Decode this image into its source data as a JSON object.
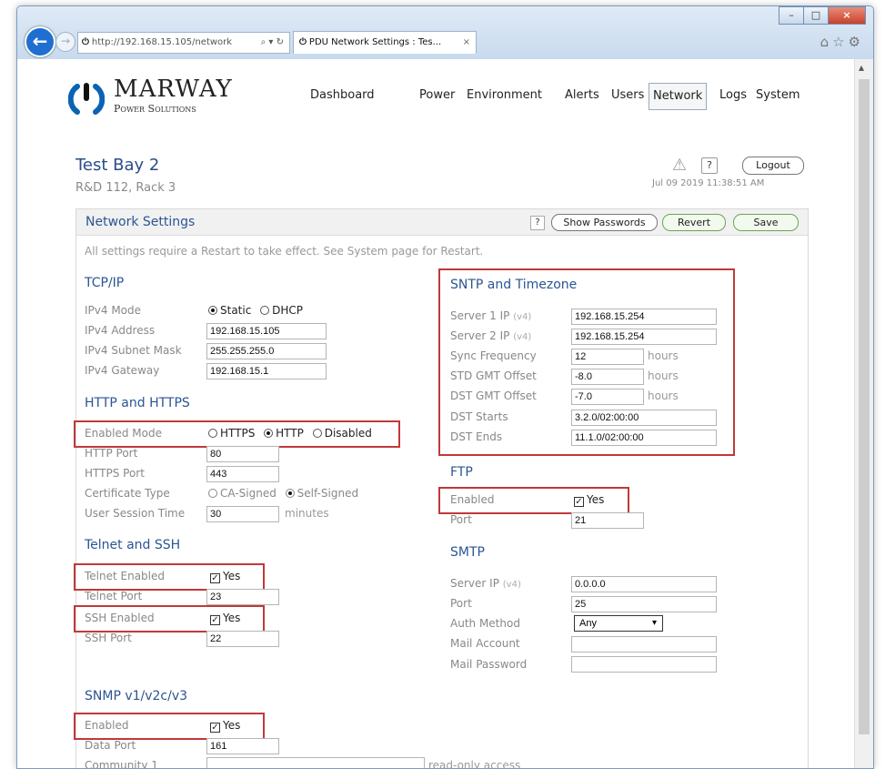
{
  "browser": {
    "url": "http://192.168.15.105/network",
    "search_controls": "⌕ ▾ ↻",
    "tab_title": "PDU Network Settings : Tes...",
    "tab_close": "×",
    "back_icon": "←",
    "forward_icon": "→",
    "toolbar_icons": "⌂☆⚙",
    "window_buttons": {
      "minimize": "–",
      "maximize": "□",
      "close": "×"
    }
  },
  "brand": {
    "name": "MARWAY",
    "sub": "Power Solutions",
    "color": "#0a63b5"
  },
  "nav": [
    "Dashboard",
    "Power",
    "Environment",
    "Alerts",
    "Users",
    "Network",
    "Logs",
    "System"
  ],
  "nav_active": "Network",
  "page": {
    "title": "Test Bay 2",
    "location": "R&D 112, Rack 3",
    "timestamp": "Jul 09 2019 11:38:51 AM",
    "logout": "Logout",
    "help": "?",
    "warn": "⚠"
  },
  "panel": {
    "title": "Network Settings",
    "help": "?",
    "show_passwords": "Show Passwords",
    "revert": "Revert",
    "save": "Save",
    "note": "All settings require a Restart to take effect. See System page for Restart."
  },
  "tcpip": {
    "title": "TCP/IP",
    "mode_label": "IPv4 Mode",
    "mode_static": "Static",
    "mode_dhcp": "DHCP",
    "mode_value": "Static",
    "address_label": "IPv4 Address",
    "address": "192.168.15.105",
    "mask_label": "IPv4 Subnet Mask",
    "mask": "255.255.255.0",
    "gateway_label": "IPv4 Gateway",
    "gateway": "192.168.15.1"
  },
  "http": {
    "title": "HTTP and HTTPS",
    "mode_label": "Enabled Mode",
    "opt_https": "HTTPS",
    "opt_http": "HTTP",
    "opt_disabled": "Disabled",
    "mode_value": "HTTP",
    "http_port_label": "HTTP Port",
    "http_port": "80",
    "https_port_label": "HTTPS Port",
    "https_port": "443",
    "cert_label": "Certificate Type",
    "cert_ca": "CA-Signed",
    "cert_self": "Self-Signed",
    "cert_value": "Self-Signed",
    "session_label": "User Session Time",
    "session": "30",
    "session_unit": "minutes"
  },
  "telnet": {
    "title": "Telnet and SSH",
    "telnet_enabled_label": "Telnet Enabled",
    "telnet_enabled": "Yes",
    "telnet_port_label": "Telnet Port",
    "telnet_port": "23",
    "ssh_enabled_label": "SSH Enabled",
    "ssh_enabled": "Yes",
    "ssh_port_label": "SSH Port",
    "ssh_port": "22"
  },
  "snmp": {
    "title": "SNMP v1/v2c/v3",
    "enabled_label": "Enabled",
    "enabled": "Yes",
    "data_port_label": "Data Port",
    "data_port": "161",
    "community1_label": "Community 1",
    "community1": "",
    "community1_note": "read-only access"
  },
  "sntp": {
    "title": "SNTP and Timezone",
    "server1_label": "Server 1 IP",
    "server1": "192.168.15.254",
    "server2_label": "Server 2 IP",
    "server2": "192.168.15.254",
    "v4": "(v4)",
    "sync_label": "Sync Frequency",
    "sync": "12",
    "hours": "hours",
    "std_label": "STD GMT Offset",
    "std": "-8.0",
    "dst_label": "DST GMT Offset",
    "dst": "-7.0",
    "dst_starts_label": "DST Starts",
    "dst_starts": "3.2.0/02:00:00",
    "dst_ends_label": "DST Ends",
    "dst_ends": "11.1.0/02:00:00"
  },
  "ftp": {
    "title": "FTP",
    "enabled_label": "Enabled",
    "enabled": "Yes",
    "port_label": "Port",
    "port": "21"
  },
  "smtp": {
    "title": "SMTP",
    "server_label": "Server IP",
    "server": "0.0.0.0",
    "port_label": "Port",
    "port": "25",
    "auth_label": "Auth Method",
    "auth": "Any",
    "account_label": "Mail Account",
    "account": "",
    "password_label": "Mail Password",
    "password": ""
  },
  "colors": {
    "highlight": "#c0393b",
    "section": "#2a5592",
    "title": "#2a4d8a"
  }
}
